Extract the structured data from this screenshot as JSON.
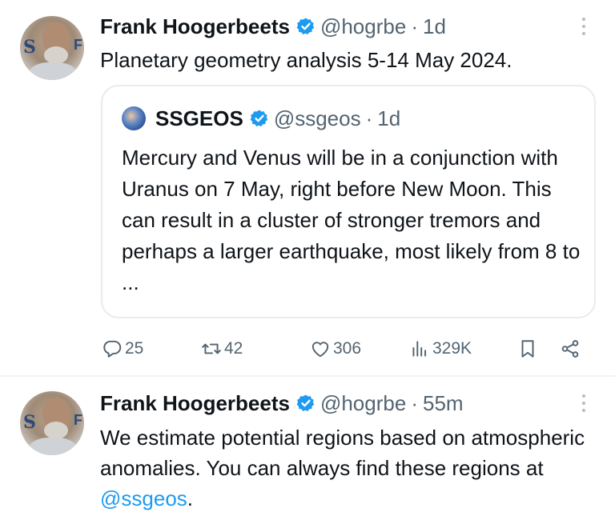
{
  "tweets": [
    {
      "display_name": "Frank Hoogerbeets",
      "handle": "@hogrbe",
      "separator": "·",
      "time": "1d",
      "text": "Planetary geometry analysis 5-14 May 2024.",
      "quote": {
        "display_name": "SSGEOS",
        "handle": "@ssgeos",
        "separator": "·",
        "time": "1d",
        "text": "Mercury and Venus will be in a conjunction with Uranus on 7 May, right before New Moon. This can result in a cluster of stronger tremors and perhaps a larger earthquake, most likely from 8 to ..."
      },
      "actions": {
        "replies": "25",
        "retweets": "42",
        "likes": "306",
        "views": "329K"
      }
    },
    {
      "display_name": "Frank Hoogerbeets",
      "handle": "@hogrbe",
      "separator": "·",
      "time": "55m",
      "text_prefix": "We estimate potential regions based on atmospheric anomalies. You can always find these regions at ",
      "mention": "@ssgeos",
      "text_suffix": "."
    }
  ],
  "icons": {
    "verified": "verified-badge-icon",
    "reply": "reply-icon",
    "retweet": "retweet-icon",
    "like": "heart-icon",
    "views": "views-icon",
    "bookmark": "bookmark-icon",
    "share": "share-icon",
    "more": "more-icon"
  },
  "colors": {
    "text": "#0f1419",
    "secondary": "#536471",
    "accent": "#1d9bf0",
    "border": "#e6ecf0"
  }
}
